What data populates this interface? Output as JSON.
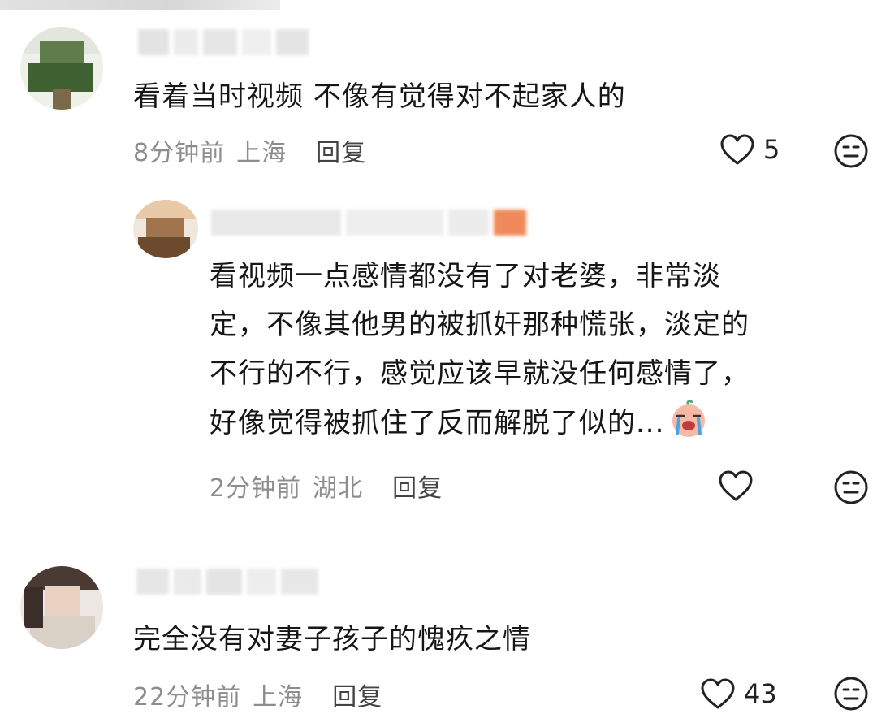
{
  "comments": [
    {
      "text_lines": [
        "看着当时视频 不像有觉得对不起家人的"
      ],
      "time": "8分钟前",
      "location": "上海",
      "reply_label": "回复",
      "like_count": "5",
      "like_icon": "heart-outline",
      "dislike_icon": "meh-face"
    },
    {
      "text_lines": [
        "看视频一点感情都没有了对老婆，非常淡",
        "定，不像其他男的被抓奸那种慌张，淡定的",
        "不行的不行，感觉应该早就没任何感情了，",
        "好像觉得被抓住了反而解脱了似的..."
      ],
      "trailing_emoji": "crying-face-emoji",
      "time": "2分钟前",
      "location": "湖北",
      "reply_label": "回复",
      "like_count": "",
      "like_icon": "heart-outline",
      "dislike_icon": "meh-face"
    },
    {
      "text_lines": [
        "完全没有对妻子孩子的愧疚之情"
      ],
      "time": "22分钟前",
      "location": "上海",
      "reply_label": "回复",
      "like_count": "43",
      "like_icon": "heart-outline",
      "dislike_icon": "meh-face"
    }
  ],
  "colors": {
    "text": "#161616",
    "meta": "#8d8d8d",
    "reply": "#444444",
    "icon": "#222222"
  }
}
